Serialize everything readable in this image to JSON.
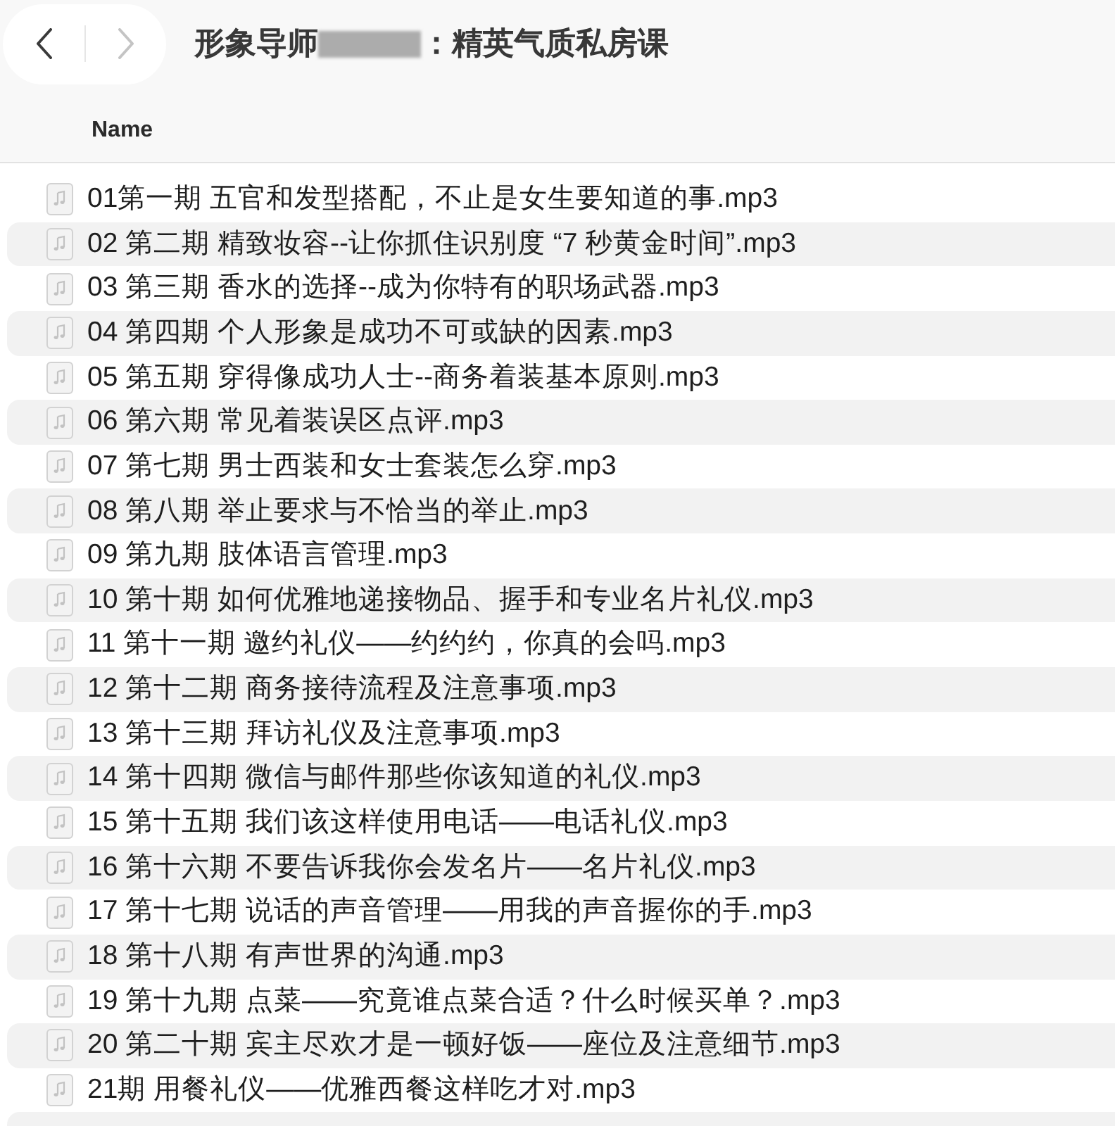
{
  "toolbar": {
    "back": {
      "disabled": false
    },
    "forward": {
      "disabled": true
    }
  },
  "title": {
    "prefix": "形象导师",
    "redacted": true,
    "suffix": "：精英气质私房课"
  },
  "columns": [
    {
      "label": "Name"
    }
  ],
  "files": [
    {
      "name": "01第一期 五官和发型搭配，不止是女生要知道的事.mp3"
    },
    {
      "name": "02 第二期 精致妆容--让你抓住识别度 “7 秒黄金时间”.mp3"
    },
    {
      "name": "03 第三期 香水的选择--成为你特有的职场武器.mp3"
    },
    {
      "name": "04 第四期 个人形象是成功不可或缺的因素.mp3"
    },
    {
      "name": "05 第五期 穿得像成功人士--商务着装基本原则.mp3"
    },
    {
      "name": "06 第六期 常见着装误区点评.mp3"
    },
    {
      "name": "07 第七期 男士西装和女士套装怎么穿.mp3"
    },
    {
      "name": "08 第八期 举止要求与不恰当的举止.mp3"
    },
    {
      "name": "09 第九期 肢体语言管理.mp3"
    },
    {
      "name": "10 第十期 如何优雅地递接物品、握手和专业名片礼仪.mp3"
    },
    {
      "name": "11 第十一期 邀约礼仪——约约约，你真的会吗.mp3"
    },
    {
      "name": "12 第十二期 商务接待流程及注意事项.mp3"
    },
    {
      "name": "13 第十三期 拜访礼仪及注意事项.mp3"
    },
    {
      "name": "14 第十四期 微信与邮件那些你该知道的礼仪.mp3"
    },
    {
      "name": "15 第十五期 我们该这样使用电话——电话礼仪.mp3"
    },
    {
      "name": "16 第十六期 不要告诉我你会发名片——名片礼仪.mp3"
    },
    {
      "name": "17 第十七期 说话的声音管理——用我的声音握你的手.mp3"
    },
    {
      "name": "18 第十八期 有声世界的沟通.mp3"
    },
    {
      "name": "19 第十九期 点菜——究竟谁点菜合适？什么时候买单？.mp3"
    },
    {
      "name": "20 第二十期 宾主尽欢才是一顿好饭——座位及注意细节.mp3"
    },
    {
      "name": "21期 用餐礼仪——优雅西餐这样吃才对.mp3"
    }
  ]
}
